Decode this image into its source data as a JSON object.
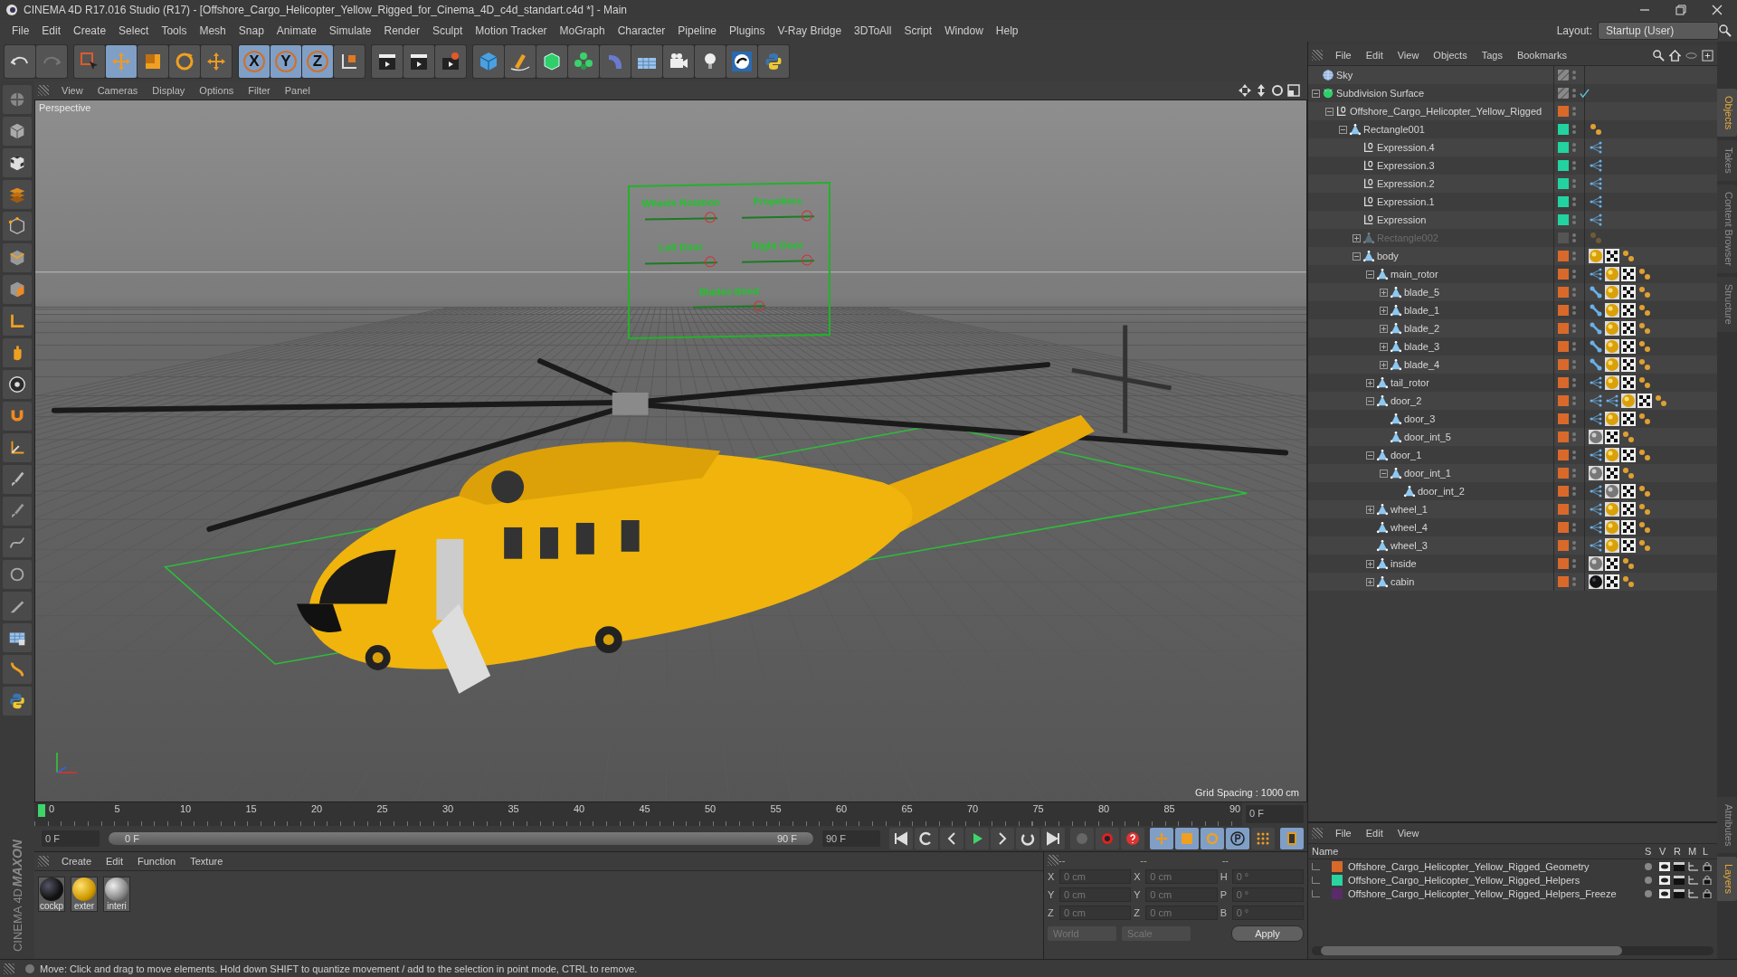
{
  "window": {
    "title": "CINEMA 4D R17.016 Studio (R17) - [Offshore_Cargo_Helicopter_Yellow_Rigged_for_Cinema_4D_c4d_standart.c4d *] - Main"
  },
  "menu": [
    "File",
    "Edit",
    "Create",
    "Select",
    "Tools",
    "Mesh",
    "Snap",
    "Animate",
    "Simulate",
    "Render",
    "Sculpt",
    "Motion Tracker",
    "MoGraph",
    "Character",
    "Pipeline",
    "Plugins",
    "V-Ray Bridge",
    "3DToAll",
    "Script",
    "Window",
    "Help"
  ],
  "layout": {
    "label": "Layout:",
    "value": "Startup (User)"
  },
  "axis_buttons": [
    {
      "label": "X",
      "selected": true
    },
    {
      "label": "Y",
      "selected": true
    },
    {
      "label": "Z",
      "selected": true
    }
  ],
  "viewport": {
    "menu": [
      "View",
      "Cameras",
      "Display",
      "Options",
      "Filter",
      "Panel"
    ],
    "camera": "Perspective",
    "grid_spacing": "Grid Spacing : 1000 cm",
    "rig_sliders": [
      {
        "label": "Wheels Rotation",
        "level": 0.92
      },
      {
        "label": "Propellers",
        "level": 0.92
      },
      {
        "label": "Left Door",
        "level": 0.92
      },
      {
        "label": "Right Door",
        "level": 0.92
      },
      {
        "label": "Blades Bend",
        "level": 0.92
      }
    ]
  },
  "timeline": {
    "ticks": [
      "0",
      "5",
      "10",
      "15",
      "20",
      "25",
      "30",
      "35",
      "40",
      "45",
      "50",
      "55",
      "60",
      "65",
      "70",
      "75",
      "80",
      "85",
      "90"
    ],
    "current_frame": "0 F",
    "start": "0 F",
    "range": {
      "start": "0 F",
      "end": "90 F",
      "level": 1
    },
    "end": "90 F"
  },
  "materials": {
    "menu": [
      "Create",
      "Edit",
      "Function",
      "Texture"
    ],
    "items": [
      {
        "name": "cockp",
        "kind": "black"
      },
      {
        "name": "exter",
        "kind": "yellow"
      },
      {
        "name": "interi",
        "kind": "grey"
      }
    ]
  },
  "coordinates": {
    "headers": [
      "--",
      "--",
      "--"
    ],
    "rows": [
      {
        "pos_label": "X",
        "pos": "0 cm",
        "size_label": "X",
        "size": "0 cm",
        "rot_label": "H",
        "rot": "0 °"
      },
      {
        "pos_label": "Y",
        "pos": "0 cm",
        "size_label": "Y",
        "size": "0 cm",
        "rot_label": "P",
        "rot": "0 °"
      },
      {
        "pos_label": "Z",
        "pos": "0 cm",
        "size_label": "Z",
        "size": "0 cm",
        "rot_label": "B",
        "rot": "0 °"
      }
    ],
    "mode": "World",
    "transform": "Scale",
    "apply": "Apply"
  },
  "logo": {
    "brand": "MAXON",
    "product": "CINEMA 4D"
  },
  "objects": {
    "menu": [
      "File",
      "Edit",
      "View",
      "Objects",
      "Tags",
      "Bookmarks"
    ],
    "tree": [
      {
        "name": "Sky",
        "kind": "sky"
      },
      {
        "name": "Subdivision Surface",
        "kind": "subdivision",
        "expanded": true,
        "enabled": true,
        "children": [
          {
            "name": "Offshore_Cargo_Helicopter_Yellow_Rigged",
            "kind": "null",
            "color": "#d9692a",
            "expanded": true,
            "children": [
              {
                "name": "Rectangle001",
                "kind": "polygon",
                "color": "#22d3a0",
                "expanded": true,
                "tags": [
                  {
                    "kind": "selection"
                  }
                ],
                "children": [
                  {
                    "name": "Expression.4",
                    "kind": "null",
                    "color": "#22d3a0",
                    "tags": [
                      {
                        "kind": "xpresso"
                      }
                    ]
                  },
                  {
                    "name": "Expression.3",
                    "kind": "null",
                    "color": "#22d3a0",
                    "tags": [
                      {
                        "kind": "xpresso"
                      }
                    ]
                  },
                  {
                    "name": "Expression.2",
                    "kind": "null",
                    "color": "#22d3a0",
                    "tags": [
                      {
                        "kind": "xpresso"
                      }
                    ]
                  },
                  {
                    "name": "Expression.1",
                    "kind": "null",
                    "color": "#22d3a0",
                    "tags": [
                      {
                        "kind": "xpresso"
                      }
                    ]
                  },
                  {
                    "name": "Expression",
                    "kind": "null",
                    "color": "#22d3a0",
                    "tags": [
                      {
                        "kind": "xpresso"
                      }
                    ]
                  },
                  {
                    "name": "Rectangle002",
                    "kind": "polygon",
                    "disabled": true,
                    "expanded": false,
                    "tags": [
                      {
                        "kind": "selection"
                      }
                    ]
                  },
                  {
                    "name": "body",
                    "kind": "polygon",
                    "color": "#d9692a",
                    "expanded": true,
                    "tags": [
                      {
                        "kind": "mat-yellow"
                      },
                      {
                        "kind": "texture"
                      },
                      {
                        "kind": "selection"
                      }
                    ],
                    "children": [
                      {
                        "name": "main_rotor",
                        "kind": "polygon",
                        "color": "#d9692a",
                        "expanded": true,
                        "tags": [
                          {
                            "kind": "xpresso"
                          },
                          {
                            "kind": "mat-yellow"
                          },
                          {
                            "kind": "texture"
                          },
                          {
                            "kind": "selection"
                          }
                        ],
                        "children": [
                          {
                            "name": "blade_5",
                            "kind": "polygon",
                            "color": "#d9692a",
                            "expanded": false,
                            "tags": [
                              {
                                "kind": "constraint"
                              },
                              {
                                "kind": "mat-yellow"
                              },
                              {
                                "kind": "texture"
                              },
                              {
                                "kind": "selection"
                              }
                            ]
                          },
                          {
                            "name": "blade_1",
                            "kind": "polygon",
                            "color": "#d9692a",
                            "expanded": false,
                            "tags": [
                              {
                                "kind": "constraint"
                              },
                              {
                                "kind": "mat-yellow"
                              },
                              {
                                "kind": "texture"
                              },
                              {
                                "kind": "selection"
                              }
                            ]
                          },
                          {
                            "name": "blade_2",
                            "kind": "polygon",
                            "color": "#d9692a",
                            "expanded": false,
                            "tags": [
                              {
                                "kind": "constraint"
                              },
                              {
                                "kind": "mat-yellow"
                              },
                              {
                                "kind": "texture"
                              },
                              {
                                "kind": "selection"
                              }
                            ]
                          },
                          {
                            "name": "blade_3",
                            "kind": "polygon",
                            "color": "#d9692a",
                            "expanded": false,
                            "tags": [
                              {
                                "kind": "constraint"
                              },
                              {
                                "kind": "mat-yellow"
                              },
                              {
                                "kind": "texture"
                              },
                              {
                                "kind": "selection"
                              }
                            ]
                          },
                          {
                            "name": "blade_4",
                            "kind": "polygon",
                            "color": "#d9692a",
                            "expanded": false,
                            "tags": [
                              {
                                "kind": "constraint"
                              },
                              {
                                "kind": "mat-yellow"
                              },
                              {
                                "kind": "texture"
                              },
                              {
                                "kind": "selection"
                              }
                            ]
                          }
                        ]
                      },
                      {
                        "name": "tail_rotor",
                        "kind": "polygon",
                        "color": "#d9692a",
                        "expanded": false,
                        "tags": [
                          {
                            "kind": "xpresso"
                          },
                          {
                            "kind": "mat-yellow"
                          },
                          {
                            "kind": "texture"
                          },
                          {
                            "kind": "selection"
                          }
                        ]
                      },
                      {
                        "name": "door_2",
                        "kind": "polygon",
                        "color": "#d9692a",
                        "expanded": true,
                        "tags": [
                          {
                            "kind": "xpresso"
                          },
                          {
                            "kind": "xpresso"
                          },
                          {
                            "kind": "mat-yellow"
                          },
                          {
                            "kind": "texture"
                          },
                          {
                            "kind": "selection"
                          }
                        ],
                        "children": [
                          {
                            "name": "door_3",
                            "kind": "polygon",
                            "color": "#d9692a",
                            "tags": [
                              {
                                "kind": "xpresso"
                              },
                              {
                                "kind": "mat-yellow"
                              },
                              {
                                "kind": "texture"
                              },
                              {
                                "kind": "selection"
                              }
                            ]
                          },
                          {
                            "name": "door_int_5",
                            "kind": "polygon",
                            "color": "#d9692a",
                            "tags": [
                              {
                                "kind": "mat-grey"
                              },
                              {
                                "kind": "texture"
                              },
                              {
                                "kind": "selection"
                              }
                            ]
                          }
                        ]
                      },
                      {
                        "name": "door_1",
                        "kind": "polygon",
                        "color": "#d9692a",
                        "expanded": true,
                        "tags": [
                          {
                            "kind": "xpresso"
                          },
                          {
                            "kind": "mat-yellow"
                          },
                          {
                            "kind": "texture"
                          },
                          {
                            "kind": "selection"
                          }
                        ],
                        "children": [
                          {
                            "name": "door_int_1",
                            "kind": "polygon",
                            "color": "#d9692a",
                            "expanded": true,
                            "tags": [
                              {
                                "kind": "mat-grey"
                              },
                              {
                                "kind": "texture"
                              },
                              {
                                "kind": "selection"
                              }
                            ],
                            "children": [
                              {
                                "name": "door_int_2",
                                "kind": "polygon",
                                "color": "#d9692a",
                                "tags": [
                                  {
                                    "kind": "xpresso"
                                  },
                                  {
                                    "kind": "mat-grey"
                                  },
                                  {
                                    "kind": "texture"
                                  },
                                  {
                                    "kind": "selection"
                                  }
                                ]
                              }
                            ]
                          }
                        ]
                      },
                      {
                        "name": "wheel_1",
                        "kind": "polygon",
                        "color": "#d9692a",
                        "expanded": false,
                        "tags": [
                          {
                            "kind": "xpresso"
                          },
                          {
                            "kind": "mat-yellow"
                          },
                          {
                            "kind": "texture"
                          },
                          {
                            "kind": "selection"
                          }
                        ]
                      },
                      {
                        "name": "wheel_4",
                        "kind": "polygon",
                        "color": "#d9692a",
                        "tags": [
                          {
                            "kind": "xpresso"
                          },
                          {
                            "kind": "mat-yellow"
                          },
                          {
                            "kind": "texture"
                          },
                          {
                            "kind": "selection"
                          }
                        ]
                      },
                      {
                        "name": "wheel_3",
                        "kind": "polygon",
                        "color": "#d9692a",
                        "tags": [
                          {
                            "kind": "xpresso"
                          },
                          {
                            "kind": "mat-yellow"
                          },
                          {
                            "kind": "texture"
                          },
                          {
                            "kind": "selection"
                          }
                        ]
                      },
                      {
                        "name": "inside",
                        "kind": "polygon",
                        "color": "#d9692a",
                        "expanded": false,
                        "tags": [
                          {
                            "kind": "mat-grey"
                          },
                          {
                            "kind": "texture"
                          },
                          {
                            "kind": "selection"
                          }
                        ]
                      },
                      {
                        "name": "cabin",
                        "kind": "polygon",
                        "color": "#d9692a",
                        "expanded": false,
                        "tags": [
                          {
                            "kind": "mat-black"
                          },
                          {
                            "kind": "texture"
                          },
                          {
                            "kind": "selection"
                          }
                        ]
                      }
                    ]
                  }
                ]
              }
            ]
          }
        ]
      }
    ]
  },
  "layers": {
    "menu": [
      "File",
      "Edit",
      "View"
    ],
    "columns": [
      "Name",
      "S",
      "V",
      "R",
      "M",
      "L"
    ],
    "rows": [
      {
        "name": "Offshore_Cargo_Helicopter_Yellow_Rigged_Geometry",
        "color": "#d9692a"
      },
      {
        "name": "Offshore_Cargo_Helicopter_Yellow_Rigged_Helpers",
        "color": "#2ad3a0"
      },
      {
        "name": "Offshore_Cargo_Helicopter_Yellow_Rigged_Helpers_Freeze",
        "color": "#5a2a6a"
      }
    ]
  },
  "side_tabs_top": [
    {
      "label": "Objects",
      "selected": true
    },
    {
      "label": "Takes",
      "selected": false
    },
    {
      "label": "Content Browser",
      "selected": false
    },
    {
      "label": "Structure",
      "selected": false
    }
  ],
  "side_tabs_bottom": [
    {
      "label": "Attributes",
      "selected": false
    },
    {
      "label": "Layers",
      "selected": true
    }
  ],
  "status_bar": {
    "text": "Move: Click and drag to move elements. Hold down SHIFT to quantize movement / add to the selection in point mode, CTRL to remove."
  }
}
